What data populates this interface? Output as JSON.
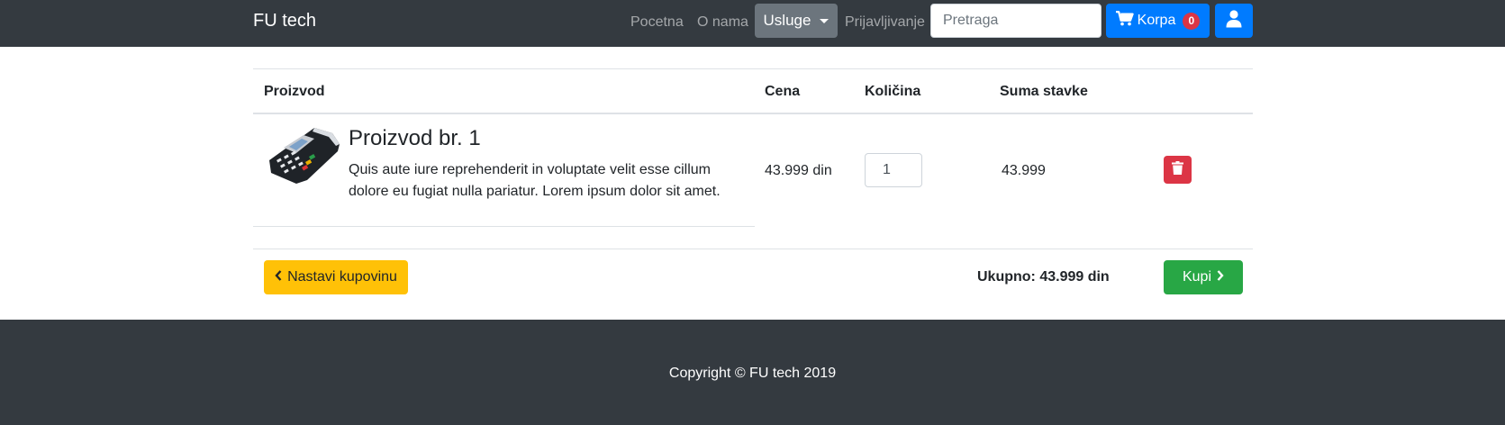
{
  "navbar": {
    "brand": "FU tech",
    "links": [
      "Pocetna",
      "O nama"
    ],
    "dropdown_label": "Usluge",
    "login_link": "Prijavljivanje",
    "search_placeholder": "Pretraga",
    "cart_label": "Korpa",
    "cart_count": "0",
    "icons": {
      "cart": "shopping-cart-icon",
      "user": "user-icon",
      "dropdown": "caret-down-icon"
    }
  },
  "cart_table": {
    "headers": [
      "Proizvod",
      "Cena",
      "Količina",
      "Suma stavke"
    ],
    "items": [
      {
        "name": "Proizvod br. 1",
        "description": "Quis aute iure reprehenderit in voluptate velit esse cillum dolore eu fugiat nulla pariatur. Lorem ipsum dolor sit amet.",
        "price": "43.999 din",
        "quantity": "1",
        "subtotal": "43.999"
      }
    ]
  },
  "actions": {
    "continue_label": "Nastavi kupovinu",
    "total_label": "Ukupno: 43.999 din",
    "buy_label": "Kupi"
  },
  "footer": {
    "copyright": "Copyright © FU tech 2019"
  },
  "colors": {
    "navbar_bg": "#343a40",
    "primary": "#007bff",
    "warning": "#ffc107",
    "success": "#28a745",
    "danger": "#dc3545",
    "secondary": "#6c757d"
  }
}
